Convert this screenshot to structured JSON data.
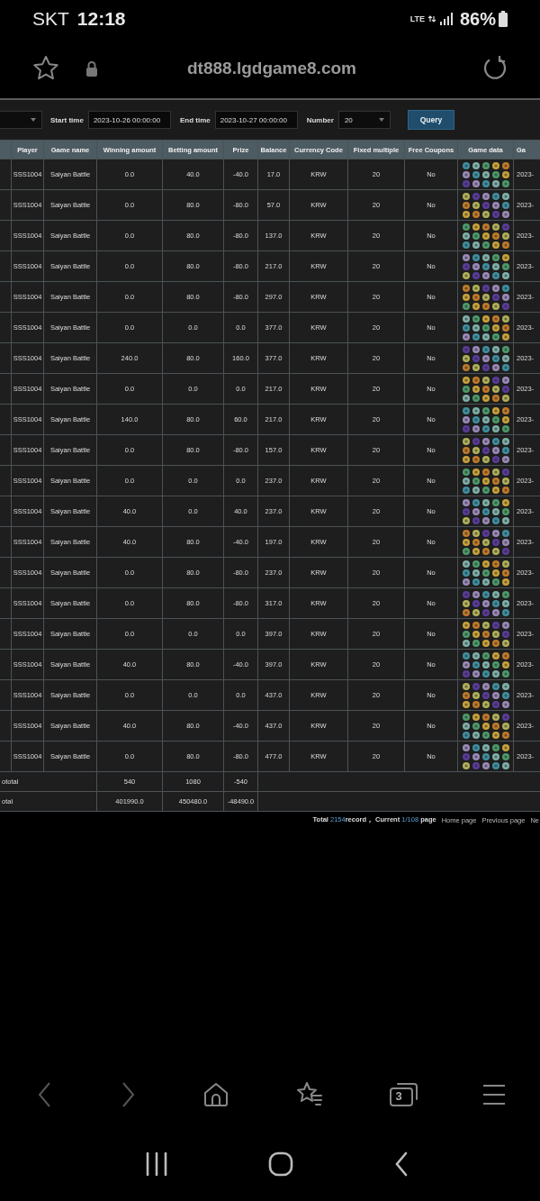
{
  "status_bar": {
    "carrier": "SKT",
    "time": "12:18",
    "network": "LTE",
    "battery": "86%"
  },
  "address_bar": {
    "url": "dt888.lgdgame8.com"
  },
  "filters": {
    "start_label": "Start time",
    "start_value": "2023-10-26 00:00:00",
    "end_label": "End time",
    "end_value": "2023-10-27 00:00:00",
    "number_label": "Number",
    "number_value": "20",
    "query_button": "Query"
  },
  "table": {
    "columns": [
      {
        "label": "Player",
        "kind": "text"
      },
      {
        "label": "Game name",
        "kind": "text"
      },
      {
        "label": "Winning amount",
        "kind": "text"
      },
      {
        "label": "Betting amount",
        "kind": "text"
      },
      {
        "label": "Prize",
        "kind": "text"
      },
      {
        "label": "Balance",
        "kind": "text"
      },
      {
        "label": "Currency Code",
        "kind": "text"
      },
      {
        "label": "Fixed multiple",
        "kind": "text"
      },
      {
        "label": "Free Coupons",
        "kind": "text"
      },
      {
        "label": "Game data",
        "kind": "drawing"
      },
      {
        "label": "Ga",
        "kind": "text"
      }
    ],
    "rows": [
      {
        "cells": [
          "SSS1004",
          "Saiyan Battle",
          "0.0",
          "40.0",
          "-40.0",
          "17.0",
          "KRW",
          "20",
          "No",
          "2023-"
        ]
      },
      {
        "cells": [
          "SSS1004",
          "Saiyan Battle",
          "0.0",
          "80.0",
          "-80.0",
          "57.0",
          "KRW",
          "20",
          "No",
          "2023-"
        ]
      },
      {
        "cells": [
          "SSS1004",
          "Saiyan Battle",
          "0.0",
          "80.0",
          "-80.0",
          "137.0",
          "KRW",
          "20",
          "No",
          "2023-"
        ]
      },
      {
        "cells": [
          "SSS1004",
          "Saiyan Battle",
          "0.0",
          "80.0",
          "-80.0",
          "217.0",
          "KRW",
          "20",
          "No",
          "2023-"
        ]
      },
      {
        "cells": [
          "SSS1004",
          "Saiyan Battle",
          "0.0",
          "80.0",
          "-80.0",
          "297.0",
          "KRW",
          "20",
          "No",
          "2023-"
        ]
      },
      {
        "cells": [
          "SSS1004",
          "Saiyan Battle",
          "0.0",
          "0.0",
          "0.0",
          "377.0",
          "KRW",
          "20",
          "No",
          "2023-"
        ]
      },
      {
        "cells": [
          "SSS1004",
          "Saiyan Battle",
          "240.0",
          "80.0",
          "160.0",
          "377.0",
          "KRW",
          "20",
          "No",
          "2023-"
        ]
      },
      {
        "cells": [
          "SSS1004",
          "Saiyan Battle",
          "0.0",
          "0.0",
          "0.0",
          "217.0",
          "KRW",
          "20",
          "No",
          "2023-"
        ]
      },
      {
        "cells": [
          "SSS1004",
          "Saiyan Battle",
          "140.0",
          "80.0",
          "60.0",
          "217.0",
          "KRW",
          "20",
          "No",
          "2023-"
        ]
      },
      {
        "cells": [
          "SSS1004",
          "Saiyan Battle",
          "0.0",
          "80.0",
          "-80.0",
          "157.0",
          "KRW",
          "20",
          "No",
          "2023-"
        ]
      },
      {
        "cells": [
          "SSS1004",
          "Saiyan Battle",
          "0.0",
          "0.0",
          "0.0",
          "237.0",
          "KRW",
          "20",
          "No",
          "2023-"
        ]
      },
      {
        "cells": [
          "SSS1004",
          "Saiyan Battle",
          "40.0",
          "0.0",
          "40.0",
          "237.0",
          "KRW",
          "20",
          "No",
          "2023-"
        ]
      },
      {
        "cells": [
          "SSS1004",
          "Saiyan Battle",
          "40.0",
          "80.0",
          "-40.0",
          "197.0",
          "KRW",
          "20",
          "No",
          "2023-"
        ]
      },
      {
        "cells": [
          "SSS1004",
          "Saiyan Battle",
          "0.0",
          "80.0",
          "-80.0",
          "237.0",
          "KRW",
          "20",
          "No",
          "2023-"
        ]
      },
      {
        "cells": [
          "SSS1004",
          "Saiyan Battle",
          "0.0",
          "80.0",
          "-80.0",
          "317.0",
          "KRW",
          "20",
          "No",
          "2023-"
        ]
      },
      {
        "cells": [
          "SSS1004",
          "Saiyan Battle",
          "0.0",
          "0.0",
          "0.0",
          "397.0",
          "KRW",
          "20",
          "No",
          "2023-"
        ]
      },
      {
        "cells": [
          "SSS1004",
          "Saiyan Battle",
          "40.0",
          "80.0",
          "-40.0",
          "397.0",
          "KRW",
          "20",
          "No",
          "2023-"
        ]
      },
      {
        "cells": [
          "SSS1004",
          "Saiyan Battle",
          "0.0",
          "0.0",
          "0.0",
          "437.0",
          "KRW",
          "20",
          "No",
          "2023-"
        ]
      },
      {
        "cells": [
          "SSS1004",
          "Saiyan Battle",
          "40.0",
          "80.0",
          "-40.0",
          "437.0",
          "KRW",
          "20",
          "No",
          "2023-"
        ]
      },
      {
        "cells": [
          "SSS1004",
          "Saiyan Battle",
          "0.0",
          "80.0",
          "-80.0",
          "477.0",
          "KRW",
          "20",
          "No",
          "2023-"
        ]
      }
    ],
    "summary_rows": [
      {
        "label": "ototal",
        "values": [
          "540",
          "1080",
          "-540"
        ]
      },
      {
        "label": "otal",
        "values": [
          "401990.0",
          "450480.0",
          "-48490.0"
        ]
      }
    ]
  },
  "pagination": {
    "total_label": "Total ",
    "total_count": "2154",
    "total_unit": "record，",
    "current_label": " Current ",
    "current_page": "1/108",
    "page_unit": " page",
    "links": [
      "Home page",
      "Previous page",
      "Ne"
    ]
  },
  "browser_toolbar": {
    "tab_count": "3"
  }
}
